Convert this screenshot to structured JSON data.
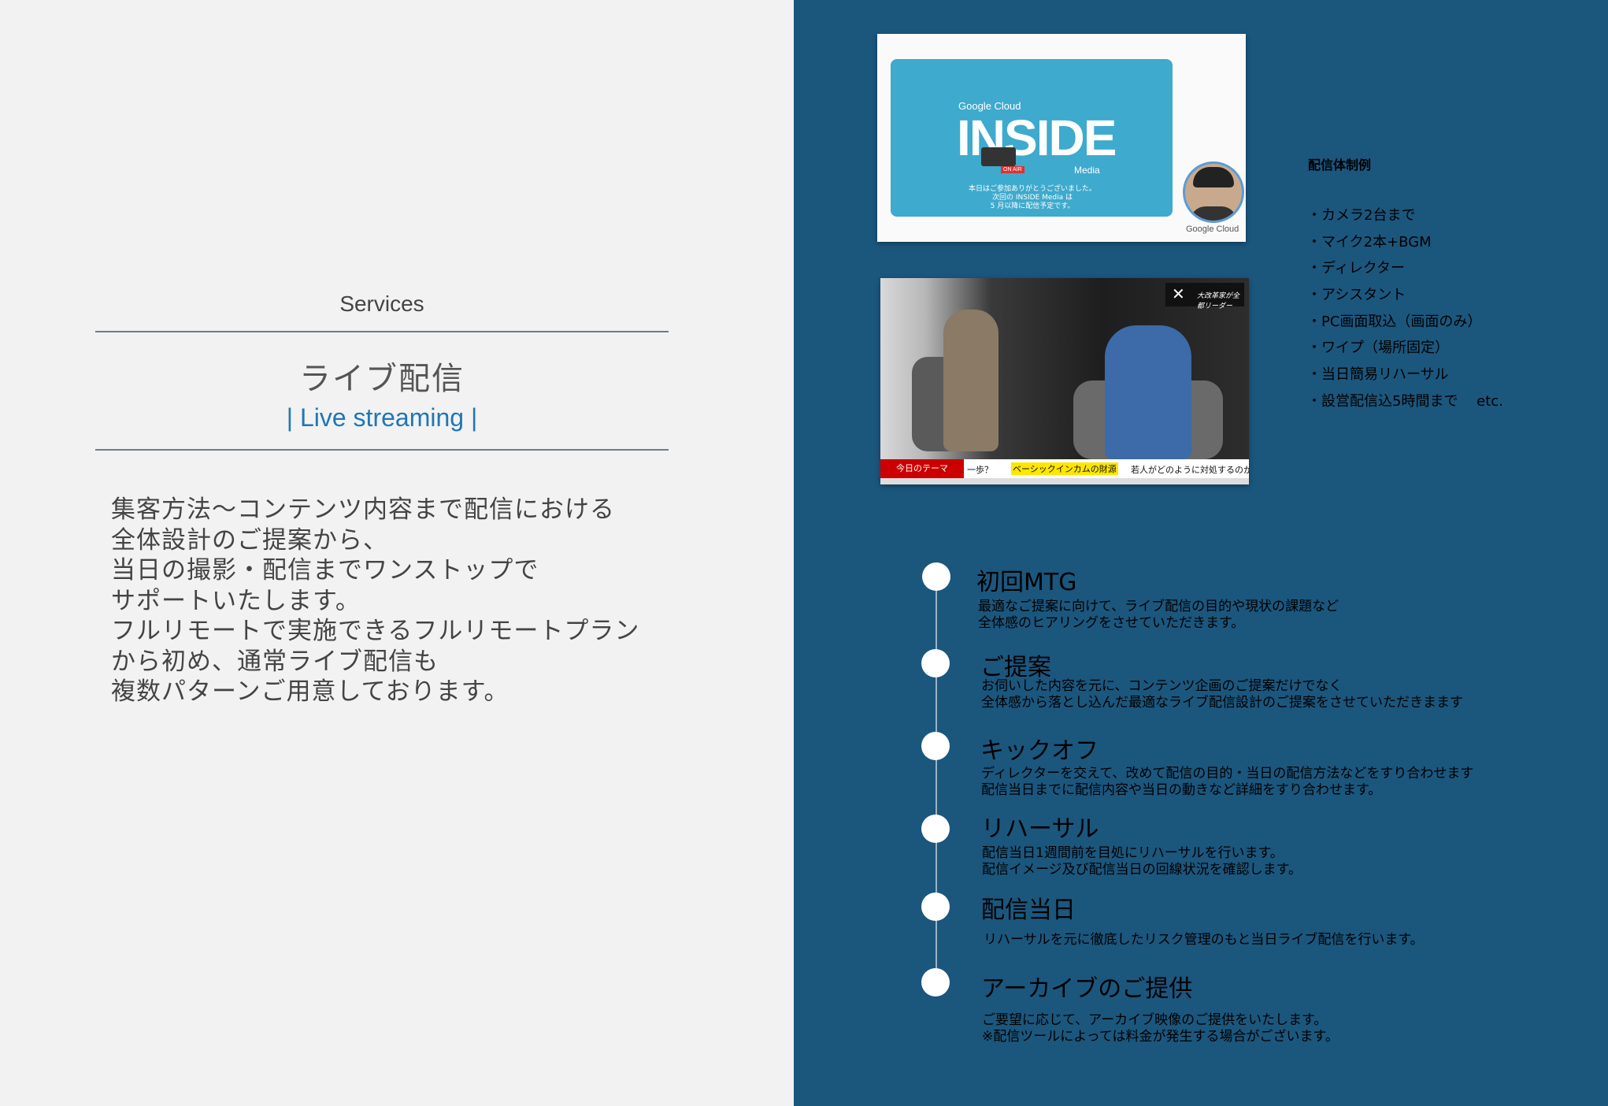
{
  "left": {
    "section_label": "Services",
    "title": "ライブ配信",
    "subtitle": "| Live streaming |",
    "description_lines": [
      "集客方法〜コンテンツ内容まで配信における",
      "全体設計のご提案から、",
      "当日の撮影・配信までワンストップで",
      "サポートいたします。",
      "フルリモートで実施できるフルリモートプラン",
      "から初め、通常ライブ配信も",
      "複数パターンご用意しております。"
    ]
  },
  "screenshot1": {
    "brand": "Google Cloud",
    "logo": "INSIDE",
    "logo_sub": "Media",
    "on_air": "ON AIR",
    "note_lines": [
      "本日はご参加ありがとうございました。",
      "次回の INSIDE Media は",
      "5 月以降に配信予定です。"
    ],
    "footer": "Google Cloud"
  },
  "screenshot2": {
    "theme_label": "今日のテーマ",
    "ticker_1": "一歩？",
    "ticker_highlight": "ベーシックインカムの財源",
    "ticker_2": "若人がどのように対処するのか",
    "badge_icon": "x-logo-icon",
    "badge_text": "大改革家が全都リーダー"
  },
  "system": {
    "title": "配信体制例",
    "items": [
      "・カメラ2台まで",
      "・マイク2本+BGM",
      "・ディレクター",
      "・アシスタント",
      "・PC画面取込（画面のみ）",
      "・ワイプ（場所固定）",
      "・当日簡易リハーサル",
      "・設営配信込5時間まで　 etc."
    ]
  },
  "steps": [
    {
      "title": "初回MTG",
      "lines": [
        "最適なご提案に向けて、ライブ配信の目的や現状の課題など",
        "全体感のヒアリングをさせていただきます。"
      ]
    },
    {
      "title": "ご提案",
      "lines": [
        "お伺いした内容を元に、コンテンツ企画のご提案だけでなく",
        "全体感から落とし込んだ最適なライブ配信設計のご提案をさせていただきまます"
      ]
    },
    {
      "title": "キックオフ",
      "lines": [
        "ディレクターを交えて、改めて配信の目的・当日の配信方法などをすり合わせます",
        "配信当日までに配信内容や当日の動きなど詳細をすり合わせます。"
      ]
    },
    {
      "title": "リハーサル",
      "lines": [
        "配信当日1週間前を目処にリハーサルを行います。",
        "配信イメージ及び配信当日の回線状況を確認します。"
      ]
    },
    {
      "title": "配信当日",
      "lines": [
        "リハーサルを元に徹底したリスク管理のもと当日ライブ配信を行います。"
      ]
    },
    {
      "title": "アーカイブのご提供",
      "lines": [
        "ご要望に応じて、アーカイブ映像のご提供をいたします。",
        "※配信ツールによっては料金が発生する場合がございます。"
      ]
    }
  ],
  "colors": {
    "left_bg": "#f2f2f2",
    "right_bg": "#1b567d",
    "accent": "#1f77b4"
  }
}
